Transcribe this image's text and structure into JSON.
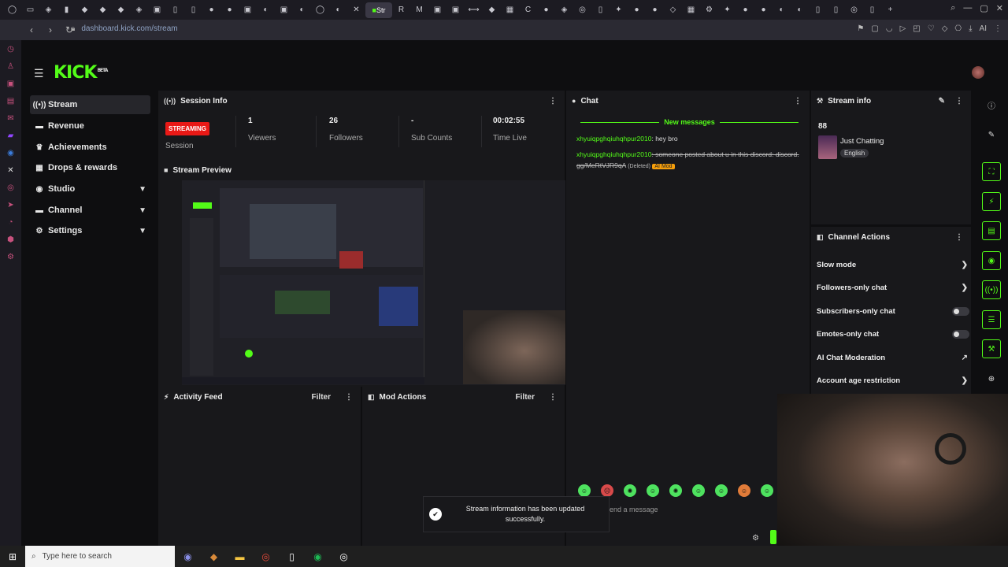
{
  "browser": {
    "url": "dashboard.kick.com/stream",
    "active_tab": "Str"
  },
  "brand": {
    "logo": "KICK",
    "sup": "BETA",
    "accent": "#53fc18"
  },
  "sidebar": {
    "items": [
      {
        "label": "Stream",
        "icon": "stream-icon"
      },
      {
        "label": "Revenue",
        "icon": "revenue-icon"
      },
      {
        "label": "Achievements",
        "icon": "trophy-icon"
      },
      {
        "label": "Drops & rewards",
        "icon": "drops-icon"
      },
      {
        "label": "Studio",
        "icon": "studio-icon"
      },
      {
        "label": "Channel",
        "icon": "channel-icon"
      },
      {
        "label": "Settings",
        "icon": "gear-icon"
      }
    ]
  },
  "session": {
    "title": "Session Info",
    "status": "STREAMING",
    "status_label": "Session",
    "viewers": {
      "value": "1",
      "label": "Viewers"
    },
    "followers": {
      "value": "26",
      "label": "Followers"
    },
    "subs": {
      "value": "-",
      "label": "Sub Counts"
    },
    "time": {
      "value": "00:02:55",
      "label": "Time Live"
    }
  },
  "preview": {
    "title": "Stream Preview"
  },
  "activity": {
    "title": "Activity Feed",
    "filter": "Filter"
  },
  "mod": {
    "title": "Mod Actions",
    "filter": "Filter"
  },
  "chat": {
    "title": "Chat",
    "new_messages": "New messages",
    "messages": [
      {
        "user": "xhyuiqpghqiuhqhpur2010",
        "text": ": hey bro"
      },
      {
        "user": "xhyuiqpghqiuhqhpur2010",
        "text": ": someone posted about u in this discord: discord. gg/MeRtVJR9qA",
        "deleted": "(Deleted)",
        "tag": "AI Mod"
      }
    ],
    "placeholder": "end a message"
  },
  "stream_info": {
    "title": "Stream info",
    "count": "88",
    "category": "Just Chatting",
    "language": "English"
  },
  "channel_actions": {
    "title": "Channel Actions",
    "items": [
      {
        "label": "Slow mode",
        "control": "chevron"
      },
      {
        "label": "Followers-only chat",
        "control": "chevron"
      },
      {
        "label": "Subscribers-only chat",
        "control": "toggle"
      },
      {
        "label": "Emotes-only chat",
        "control": "toggle"
      },
      {
        "label": "AI Chat Moderation",
        "control": "external"
      },
      {
        "label": "Account age restriction",
        "control": "chevron"
      }
    ]
  },
  "toast": {
    "text": "Stream information has been updated successfully."
  },
  "taskbar": {
    "search_placeholder": "Type here to search"
  }
}
